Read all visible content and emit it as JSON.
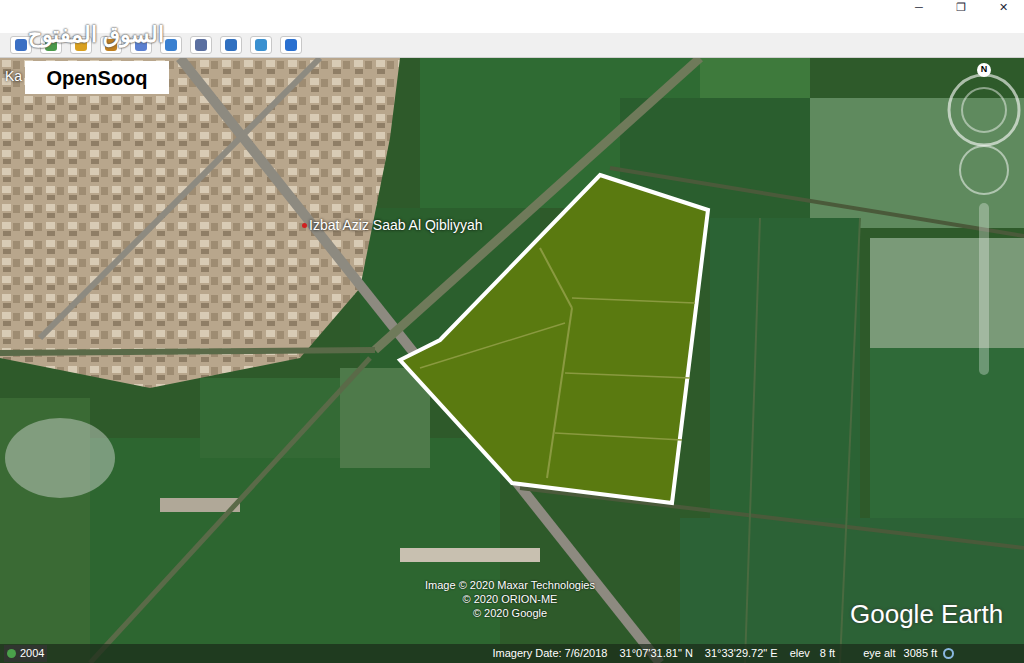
{
  "window": {
    "controls": [
      "─",
      "❐",
      "✕"
    ]
  },
  "watermark": {
    "arabic": "السوق المفتوح",
    "logo": "OpenSooq"
  },
  "map": {
    "place_labels": [
      {
        "text": "Ka"
      },
      {
        "text": "Izbat Aziz Saab Al Qibliyyah"
      }
    ],
    "compass": "N",
    "attribution": [
      "Image © 2020 Maxar Technologies",
      "© 2020 ORION-ME",
      "© 2020 Google"
    ],
    "brand": "Google Earth"
  },
  "status_bar": {
    "year": "2004",
    "imagery_date": "Imagery Date: 7/6/2018",
    "latitude": "31°07'31.81\" N",
    "longitude": "31°33'29.72\" E",
    "elev_label": "elev",
    "elev": "8 ft",
    "eye_alt_label": "eye alt",
    "eye_alt": "3085 ft"
  }
}
